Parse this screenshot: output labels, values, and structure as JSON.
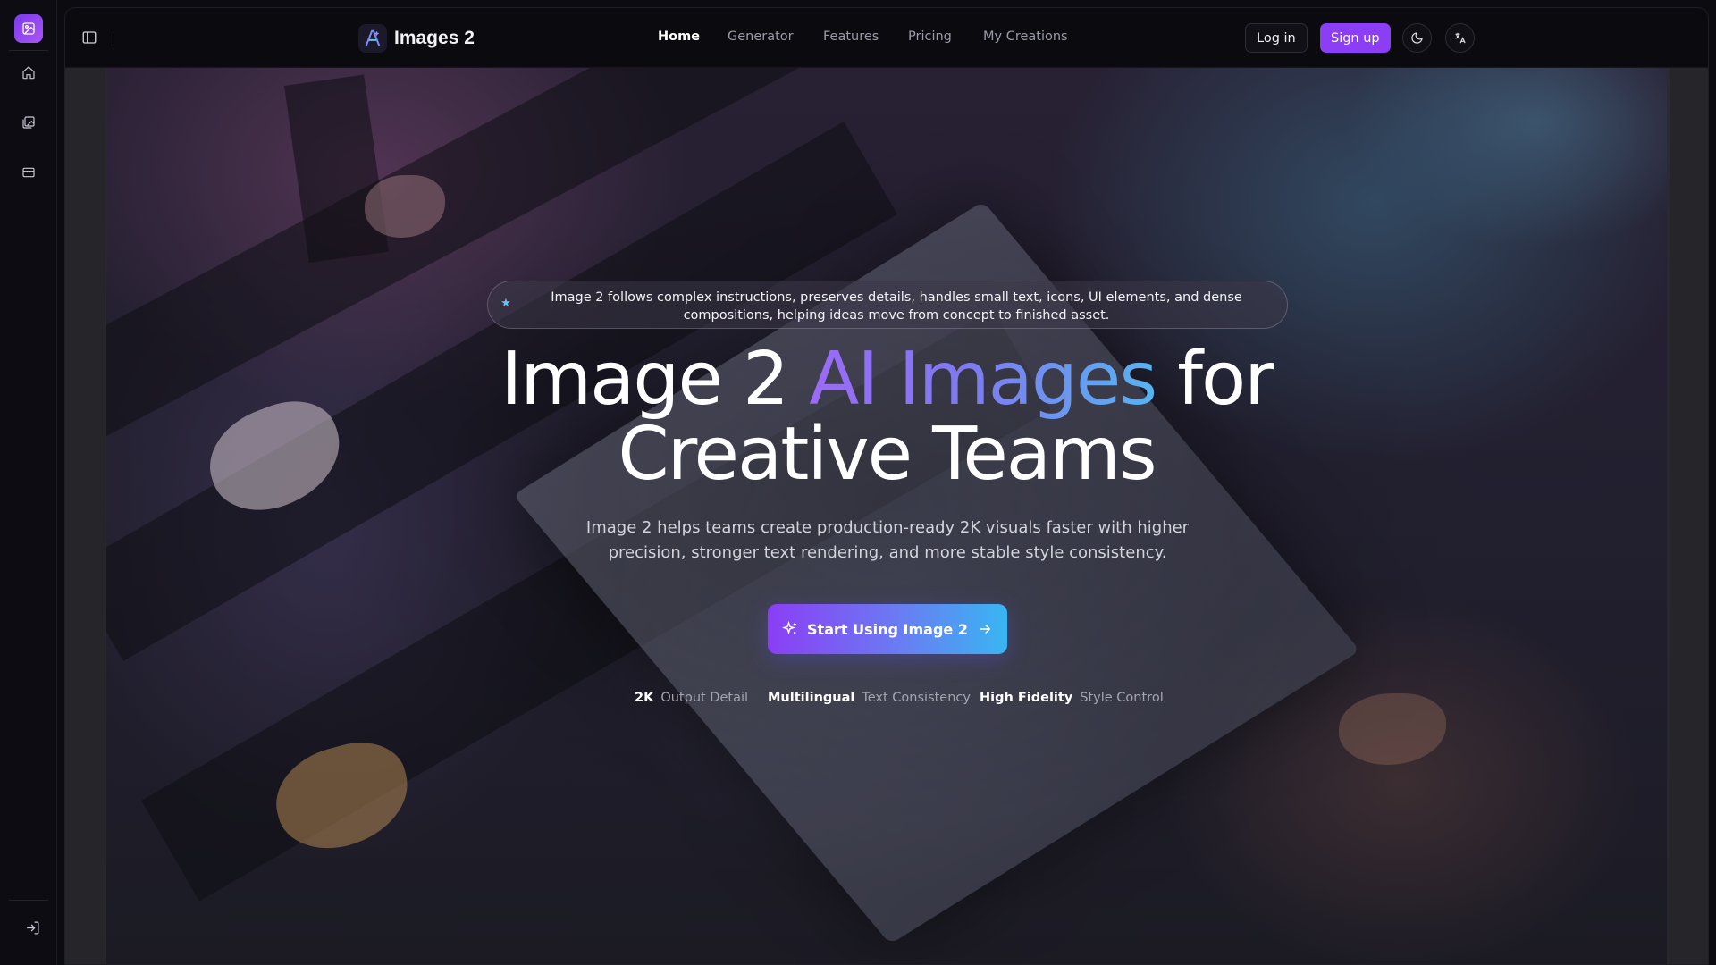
{
  "brand": {
    "name": "Images 2"
  },
  "nav": {
    "items": [
      {
        "label": "Home",
        "active": true
      },
      {
        "label": "Generator",
        "active": false
      },
      {
        "label": "Features",
        "active": false
      },
      {
        "label": "Pricing",
        "active": false
      },
      {
        "label": "My Creations",
        "active": false
      }
    ]
  },
  "auth": {
    "login_label": "Log in",
    "signup_label": "Sign up"
  },
  "rail": {
    "items": [
      "home-icon",
      "gallery-icon",
      "billing-icon"
    ],
    "bottom": "sign-in-icon"
  },
  "header_icons": [
    "moon-icon",
    "translate-icon"
  ],
  "hero": {
    "pill_text": "Image 2 follows complex instructions, preserves details, handles small text, icons, UI elements, and dense compositions, helping ideas move from concept to finished asset.",
    "title_part1": "Image 2",
    "title_highlight": "AI Images",
    "title_part2": "for",
    "title_line2": "Creative Teams",
    "subtitle": "Image 2 helps teams create production-ready 2K visuals faster with higher precision, stronger text rendering, and more stable style consistency.",
    "cta_label": "Start Using Image 2",
    "stats": [
      {
        "key": "2K",
        "value": "Output Detail"
      },
      {
        "key": "Multilingual",
        "value": "Text Consistency"
      },
      {
        "key": "High Fidelity",
        "value": "Style Control"
      }
    ]
  },
  "colors": {
    "accent": "#8b3ef5",
    "gradient_start": "#9b6bf5",
    "gradient_end": "#58b3f0",
    "star": "#5ec8f5"
  }
}
